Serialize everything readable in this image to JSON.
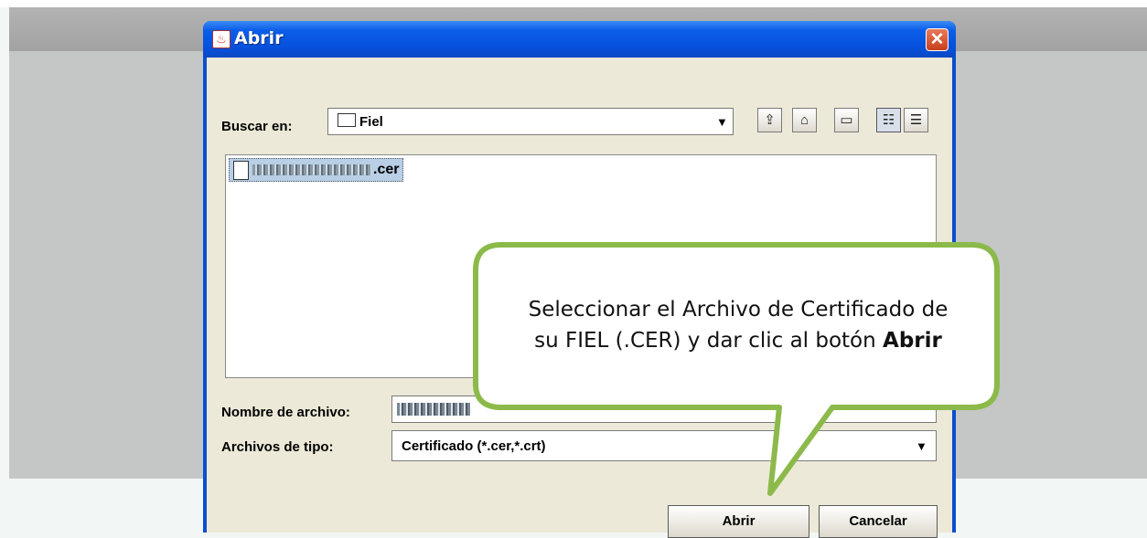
{
  "dialog": {
    "title": "Abrir",
    "close_glyph": "✕",
    "look_in_label": "Buscar en:",
    "look_in_value": "Fiel",
    "toolbar": [
      {
        "icon": "up-folder-icon",
        "glyph": "⇪"
      },
      {
        "icon": "home-icon",
        "glyph": "⌂"
      },
      {
        "icon": "new-folder-icon",
        "glyph": "▭"
      },
      {
        "icon": "list-view-icon",
        "glyph": "☷"
      },
      {
        "icon": "details-view-icon",
        "glyph": "☰"
      }
    ],
    "file_list": [
      {
        "name": ".cer",
        "selected": true
      }
    ],
    "file_name_label": "Nombre de archivo:",
    "file_type_label": "Archivos de tipo:",
    "file_type_value": "Certificado (*.cer,*.crt)",
    "open_button": "Abrir",
    "cancel_button": "Cancelar"
  },
  "callout": {
    "line1": "Seleccionar el Archivo de Certificado de",
    "line2_prefix": "su FIEL (.CER) y dar clic al botón ",
    "line2_bold": "Abrir",
    "border_color": "#8cba4a"
  }
}
